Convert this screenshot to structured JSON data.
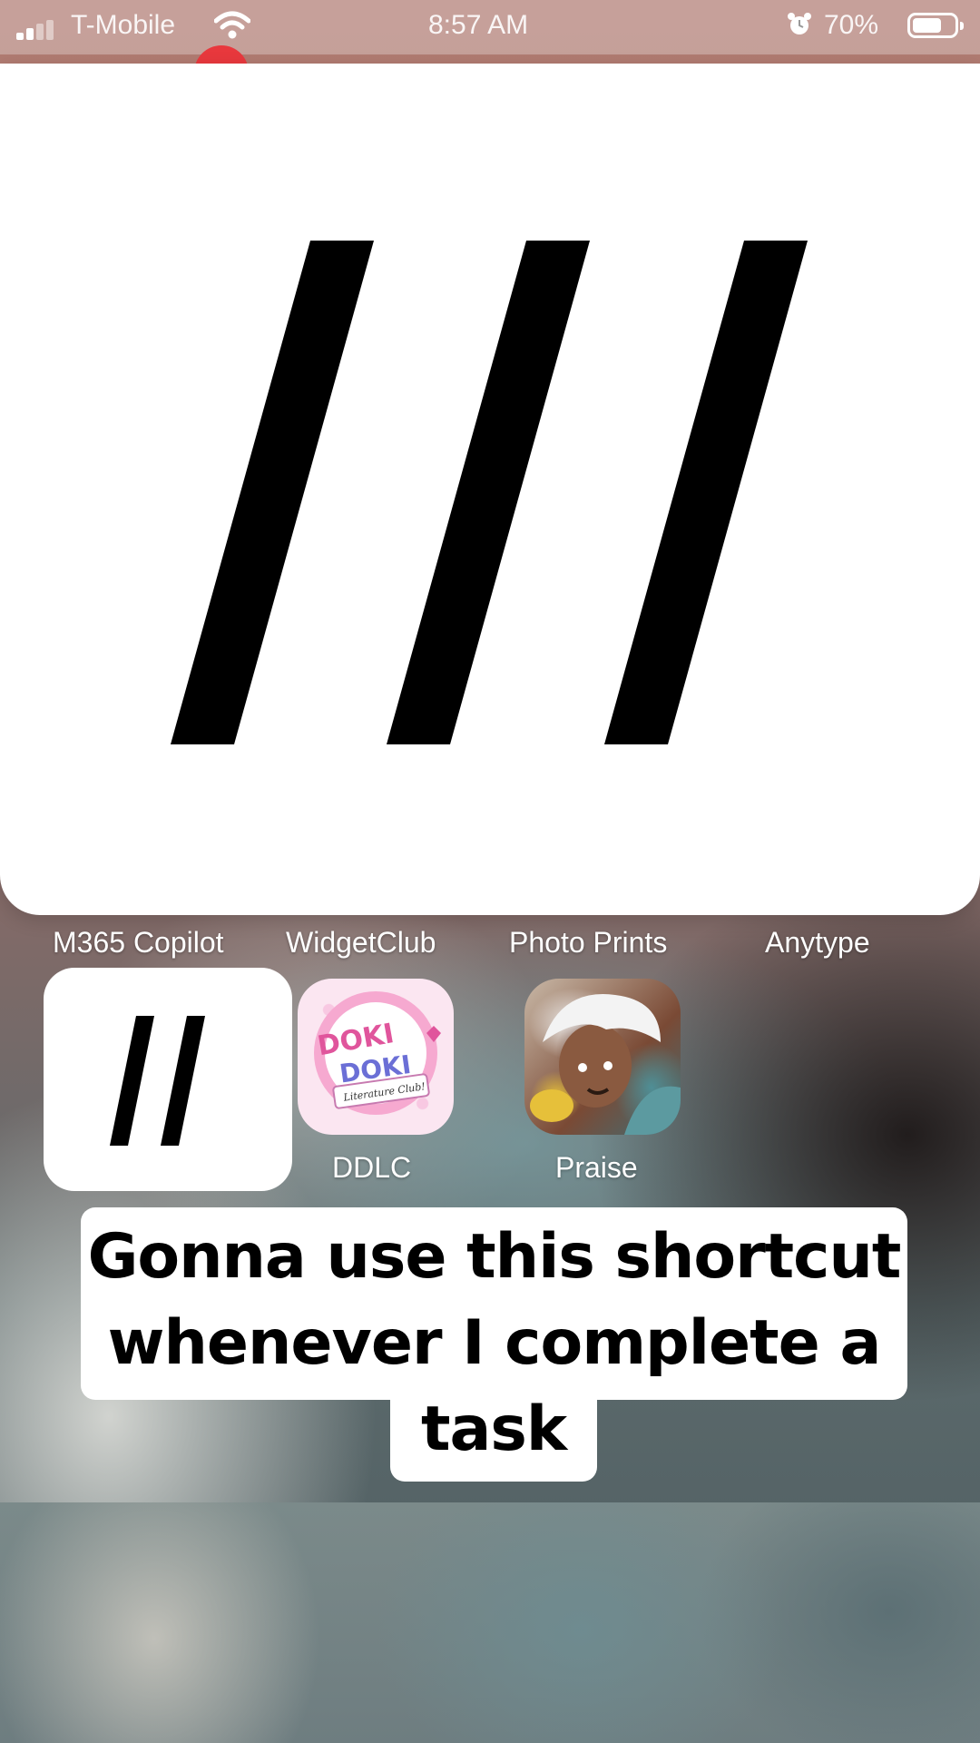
{
  "status_bar": {
    "carrier": "T-Mobile",
    "time": "8:57 AM",
    "battery_percent": "70%",
    "battery_level": 0.7
  },
  "shortcut_widget": {
    "glyph": "///"
  },
  "app_labels": {
    "m365": "M365 Copilot",
    "widgetclub": "WidgetClub",
    "photo_prints": "Photo Prints",
    "anytype": "Anytype"
  },
  "small_widget": {
    "glyph": "//"
  },
  "apps": [
    {
      "name": "DDLC",
      "logo_text": "DOKI DOKI",
      "logo_subtext": "Literature Club!"
    },
    {
      "name": "Praise"
    }
  ],
  "caption": {
    "line1": "Gonna use this shortcut",
    "line2": "whenever I complete a",
    "line3": "task"
  },
  "colors": {
    "notification_dot": "#e8383d",
    "ddlc_pink": "#f6a9d0"
  }
}
